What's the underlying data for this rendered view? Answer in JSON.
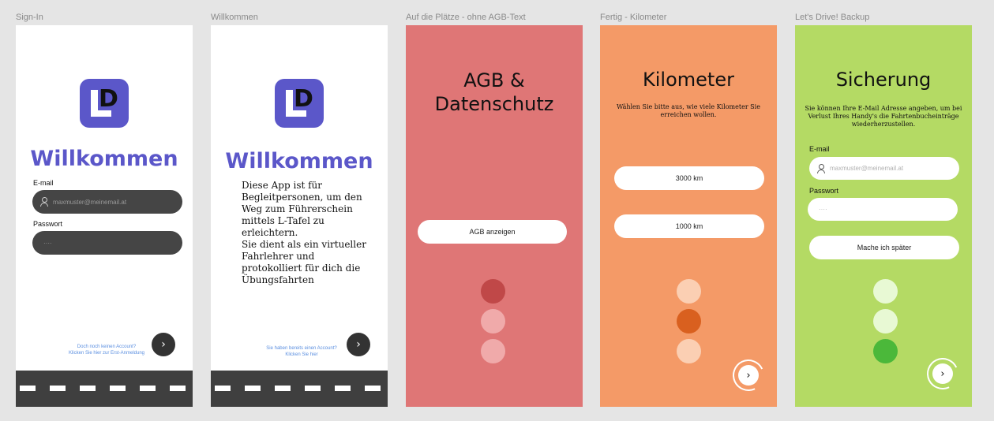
{
  "frames": [
    {
      "label": "Sign-In"
    },
    {
      "label": "Willkommen"
    },
    {
      "label": "Auf die Plätze - ohne AGB-Text"
    },
    {
      "label": "Fertig - Kilometer"
    },
    {
      "label": "Let's Drive! Backup"
    }
  ],
  "signin": {
    "welcome": "Willkommen",
    "email_label": "E-mail",
    "email_placeholder": "maxmuster@meinemail.at",
    "password_label": "Passwort",
    "password_placeholder": "····",
    "link_line1": "Doch noch keinen Account?",
    "link_line2": "Klicken Sie hier zur Erst-Anmeldung",
    "next": "›"
  },
  "welcome_screen": {
    "welcome": "Willkommen",
    "intro": "Diese App ist für Begleitpersonen, um den Weg zum Führerschein mittels L-Tafel zu erleichtern.\nSie dient als ein virtueller Fahrlehrer und protokolliert für dich die Übungsfahrten",
    "link_line1": "Sie haben bereits einen Account?",
    "link_line2": "Klicken Sie hier",
    "next": "›"
  },
  "agb": {
    "title_line1": "AGB &",
    "title_line2": "Datenschutz",
    "button": "AGB anzeigen"
  },
  "kilometer": {
    "title": "Kilometer",
    "subtitle": "Wählen Sie bitte aus, wie viele Kilometer Sie erreichen wollen.",
    "option1": "3000 km",
    "option2": "1000 km",
    "next": "›"
  },
  "backup": {
    "title": "Sicherung",
    "subtitle": "Sie können Ihre E-Mail Adresse angeben, um bei Verlust Ihres Handy's die Fahrtenbucheinträge wiederherzustellen.",
    "email_label": "E-mail",
    "email_placeholder": "maxmuster@meinemail.at",
    "password_label": "Passwort",
    "password_placeholder": "····",
    "later_button": "Mache ich später",
    "next": "›"
  },
  "colors": {
    "brand": "#5b57c9",
    "agb_bg": "#df7676",
    "km_bg": "#f49a67",
    "backup_bg": "#b4da64"
  },
  "logo_letters": "LD"
}
